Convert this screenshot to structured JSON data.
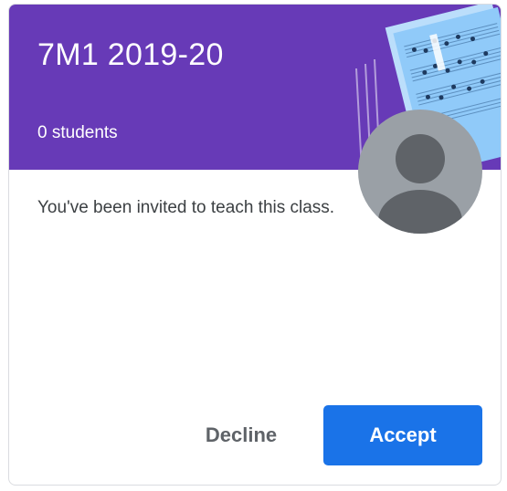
{
  "card": {
    "title": "7M1 2019-20",
    "student_count": "0 students",
    "invite_message": "You've been invited to teach this class.",
    "decline_label": "Decline",
    "accept_label": "Accept"
  },
  "colors": {
    "banner": "#673ab7",
    "accept_button": "#1a73e8",
    "avatar_bg": "#9aa0a6",
    "avatar_figure": "#5f6368"
  },
  "icons": {
    "banner_illustration": "sheet-music-icon",
    "avatar": "default-user-avatar-icon"
  }
}
